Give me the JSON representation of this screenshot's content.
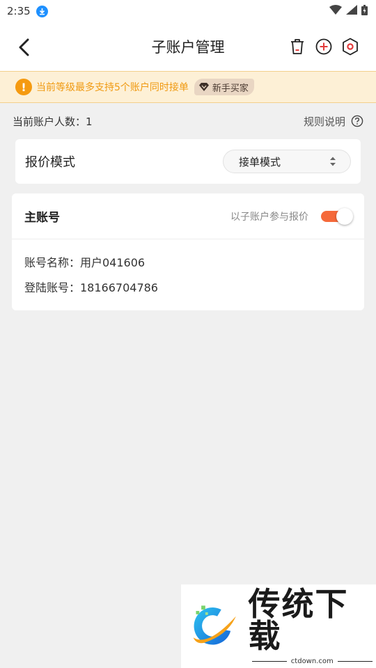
{
  "status_bar": {
    "time": "2:35"
  },
  "navbar": {
    "title": "子账户管理"
  },
  "notice": {
    "text": "当前等级最多支持5个账户同时接单",
    "badge_label": "新手买家"
  },
  "summary": {
    "count_label": "当前账户人数：1",
    "rules_label": "规则说明"
  },
  "quote_mode": {
    "label": "报价模式",
    "selected": "接单模式"
  },
  "master": {
    "title": "主账号",
    "sub_quote_label": "以子账户参与报价",
    "sub_quote_enabled": true,
    "name_label": "账号名称：用户041606",
    "login_label": "登陆账号：18166704786"
  },
  "watermark": {
    "title": "传统下载",
    "url": "ctdown.com"
  },
  "colors": {
    "accent": "#f5693a",
    "notice_text": "#f09a12",
    "notice_bg": "#fdf0d6"
  }
}
